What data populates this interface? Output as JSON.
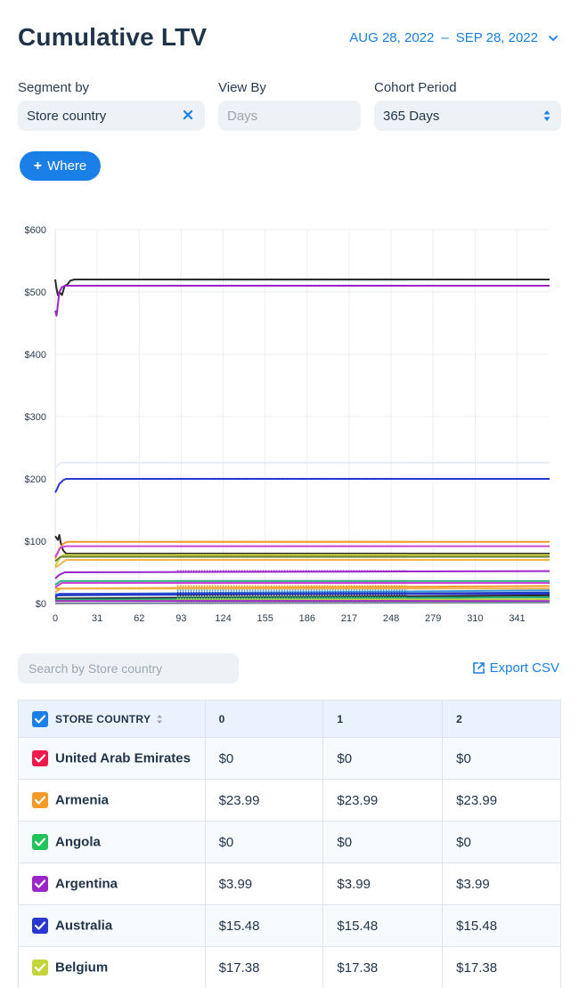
{
  "header": {
    "title": "Cumulative LTV",
    "date_start": "AUG 28, 2022",
    "date_sep": "–",
    "date_end": "SEP 28, 2022"
  },
  "filters": {
    "segment_label": "Segment by",
    "segment_value": "Store country",
    "viewby_label": "View By",
    "viewby_placeholder": "Days",
    "cohort_label": "Cohort Period",
    "cohort_value": "365 Days"
  },
  "where_button": {
    "label": "Where"
  },
  "chart_data": {
    "type": "line",
    "title": "",
    "xlabel": "",
    "ylabel": "",
    "x_ticks": [
      "0",
      "31",
      "62",
      "93",
      "124",
      "155",
      "186",
      "217",
      "248",
      "279",
      "310",
      "341"
    ],
    "y_ticks": [
      "$0",
      "$100",
      "$200",
      "$300",
      "$400",
      "$500",
      "$600"
    ],
    "xlim": [
      0,
      365
    ],
    "ylim": [
      0,
      600
    ],
    "grid": true,
    "series": [
      {
        "color": "#2b2b2b",
        "points": [
          [
            0,
            520
          ],
          [
            1,
            505
          ],
          [
            2,
            495
          ],
          [
            3,
            500
          ],
          [
            5,
            495
          ],
          [
            7,
            510
          ],
          [
            9,
            512
          ],
          [
            11,
            518
          ],
          [
            14,
            520
          ],
          [
            365,
            520
          ]
        ]
      },
      {
        "color": "#9b27c9",
        "points": [
          [
            0,
            470
          ],
          [
            1,
            462
          ],
          [
            2,
            480
          ],
          [
            3,
            500
          ],
          [
            5,
            508
          ],
          [
            8,
            510
          ],
          [
            365,
            510
          ]
        ]
      },
      {
        "color": "#e8ecf6",
        "points": [
          [
            0,
            218
          ],
          [
            2,
            222
          ],
          [
            4,
            226
          ],
          [
            365,
            226
          ]
        ]
      },
      {
        "color": "#2838d0",
        "points": [
          [
            0,
            178
          ],
          [
            1,
            182
          ],
          [
            3,
            192
          ],
          [
            6,
            198
          ],
          [
            8,
            200
          ],
          [
            365,
            200
          ]
        ]
      },
      {
        "color": "#2b2b2b",
        "points": [
          [
            0,
            108
          ],
          [
            2,
            102
          ],
          [
            3,
            110
          ],
          [
            4,
            98
          ],
          [
            5,
            90
          ],
          [
            6,
            85
          ],
          [
            8,
            80
          ],
          [
            365,
            80
          ]
        ]
      },
      {
        "color": "#f39a2b",
        "points": [
          [
            0,
            72
          ],
          [
            3,
            88
          ],
          [
            6,
            96
          ],
          [
            9,
            99
          ],
          [
            365,
            99
          ]
        ]
      },
      {
        "color": "#c94bd6",
        "points": [
          [
            0,
            75
          ],
          [
            4,
            90
          ],
          [
            8,
            92
          ],
          [
            365,
            92
          ]
        ]
      },
      {
        "color": "#c4d43a",
        "points": [
          [
            0,
            60
          ],
          [
            3,
            72
          ],
          [
            6,
            78
          ],
          [
            365,
            78
          ]
        ]
      },
      {
        "color": "#6b7b2a",
        "points": [
          [
            0,
            68
          ],
          [
            4,
            75
          ],
          [
            365,
            75
          ]
        ]
      },
      {
        "color": "#f0b24a",
        "points": [
          [
            0,
            58
          ],
          [
            3,
            62
          ],
          [
            8,
            70
          ],
          [
            365,
            70
          ]
        ]
      },
      {
        "color": "#9b27c9",
        "points": [
          [
            0,
            40
          ],
          [
            3,
            46
          ],
          [
            7,
            50
          ],
          [
            365,
            52
          ]
        ]
      },
      {
        "color": "#22b37a",
        "points": [
          [
            0,
            30
          ],
          [
            4,
            36
          ],
          [
            365,
            36
          ]
        ]
      },
      {
        "color": "#d03ad9",
        "points": [
          [
            0,
            26
          ],
          [
            5,
            33
          ],
          [
            365,
            33
          ]
        ]
      },
      {
        "color": "#f39a2b",
        "points": [
          [
            0,
            24
          ],
          [
            365,
            28
          ]
        ]
      },
      {
        "color": "#f0b24a",
        "points": [
          [
            0,
            18
          ],
          [
            4,
            24
          ],
          [
            365,
            24
          ]
        ]
      },
      {
        "color": "#3a98d8",
        "points": [
          [
            0,
            15
          ],
          [
            365,
            21
          ]
        ]
      },
      {
        "color": "#1a3fb8",
        "points": [
          [
            0,
            13
          ],
          [
            365,
            17.38
          ]
        ]
      },
      {
        "color": "#2838d0",
        "points": [
          [
            0,
            10
          ],
          [
            3,
            15.48
          ],
          [
            365,
            15.48
          ]
        ]
      },
      {
        "color": "#2b2b2b",
        "points": [
          [
            0,
            8
          ],
          [
            365,
            13
          ]
        ]
      },
      {
        "color": "#22b37a",
        "points": [
          [
            0,
            6
          ],
          [
            365,
            10
          ]
        ]
      },
      {
        "color": "#c4d43a",
        "points": [
          [
            0,
            4
          ],
          [
            365,
            7
          ]
        ]
      },
      {
        "color": "#9b27c9",
        "points": [
          [
            0,
            3.99
          ],
          [
            365,
            3.99
          ]
        ]
      },
      {
        "color": "#7a8a9a",
        "points": [
          [
            0,
            0
          ],
          [
            365,
            1.5
          ]
        ]
      }
    ]
  },
  "search": {
    "placeholder": "Search by Store country"
  },
  "export": {
    "label": "Export CSV"
  },
  "table": {
    "headers": [
      "STORE COUNTRY",
      "0",
      "1",
      "2"
    ],
    "rows": [
      {
        "country": "United Arab Emirates",
        "color": "#f0194b",
        "values": [
          "$0",
          "$0",
          "$0"
        ]
      },
      {
        "country": "Armenia",
        "color": "#f39a2b",
        "values": [
          "$23.99",
          "$23.99",
          "$23.99"
        ]
      },
      {
        "country": "Angola",
        "color": "#22c35a",
        "values": [
          "$0",
          "$0",
          "$0"
        ]
      },
      {
        "country": "Argentina",
        "color": "#9b27c9",
        "values": [
          "$3.99",
          "$3.99",
          "$3.99"
        ]
      },
      {
        "country": "Australia",
        "color": "#2838d0",
        "values": [
          "$15.48",
          "$15.48",
          "$15.48"
        ]
      },
      {
        "country": "Belgium",
        "color": "#c4d43a",
        "values": [
          "$17.38",
          "$17.38",
          "$17.38"
        ]
      }
    ],
    "header_check_color": "#1a7fe6"
  }
}
